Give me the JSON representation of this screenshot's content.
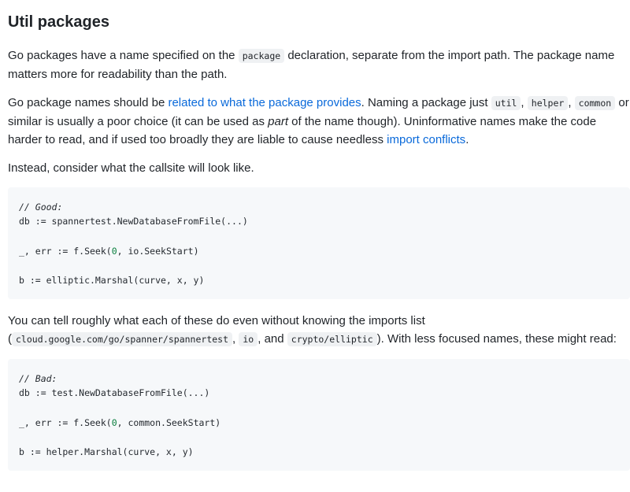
{
  "heading": "Util packages",
  "p1": {
    "a": "Go packages have a name specified on the ",
    "code": "package",
    "b": " declaration, separate from the import path. The package name matters more for readability than the path."
  },
  "p2": {
    "a": "Go package names should be ",
    "link1": "related to what the package provides",
    "b": ". Naming a package just ",
    "code1": "util",
    "c": ", ",
    "code2": "helper",
    "d": ", ",
    "code3": "common",
    "e": " or similar is usually a poor choice (it can be used as ",
    "em": "part",
    "f": " of the name though). Uninformative names make the code harder to read, and if used too broadly they are liable to cause needless ",
    "link2": "import conflicts",
    "g": "."
  },
  "p3": "Instead, consider what the callsite will look like.",
  "code_good": {
    "comment": "// Good:",
    "line1": "db := spannertest.NewDatabaseFromFile(...)",
    "line2_a": "_, err := f.Seek(",
    "line2_num": "0",
    "line2_b": ", io.SeekStart)",
    "line3": "b := elliptic.Marshal(curve, x, y)"
  },
  "p4": {
    "a": "You can tell roughly what each of these do even without knowing the imports list (",
    "code1": "cloud.google.com/go/spanner/spannertest",
    "b": ", ",
    "code2": "io",
    "c": ", and ",
    "code3": "crypto/elliptic",
    "d": "). With less focused names, these might read:"
  },
  "code_bad": {
    "comment": "// Bad:",
    "line1": "db := test.NewDatabaseFromFile(...)",
    "line2_a": "_, err := f.Seek(",
    "line2_num": "0",
    "line2_b": ", common.SeekStart)",
    "line3": "b := helper.Marshal(curve, x, y)"
  },
  "colors": {
    "link": "#0969da",
    "code_bg": "#f6f8fa",
    "inline_code_bg": "#eff1f3",
    "comment": "#6e7781",
    "number": "#0a7f3e"
  }
}
